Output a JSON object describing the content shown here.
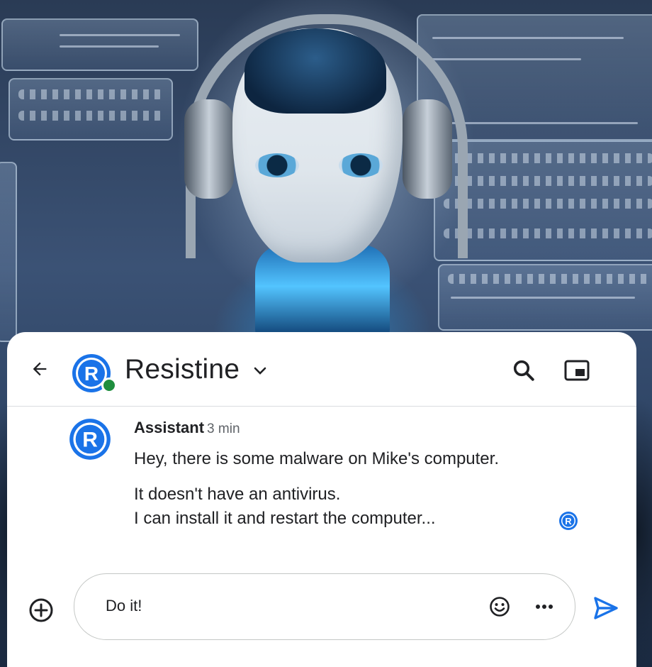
{
  "header": {
    "title": "Resistine",
    "back_icon": "arrow-left-icon",
    "search_icon": "search-icon",
    "pip_icon": "picture-in-picture-icon",
    "status_color": "#1e8e3e",
    "logo_letter": "R",
    "logo_color": "#1a73e8"
  },
  "message": {
    "sender": "Assistant",
    "time": "3 min",
    "lines": [
      "Hey, there is some malware on Mike's computer.",
      "It doesn't have an antivirus.",
      "I can install it and restart the computer..."
    ],
    "read_receipt_icon": "read-receipt-avatar-icon"
  },
  "composer": {
    "value": "Do it!",
    "add_icon": "add-circle-icon",
    "emoji_icon": "emoji-icon",
    "more_icon": "more-horizontal-icon",
    "send_icon": "send-icon",
    "send_color": "#1a73e8"
  }
}
